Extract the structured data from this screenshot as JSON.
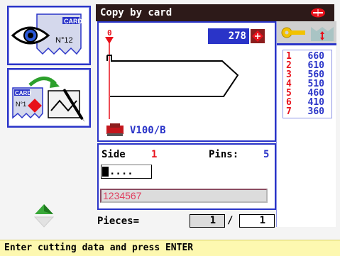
{
  "title_bar": {
    "title": "Copy by card"
  },
  "left_buttons": {
    "view_card": {
      "card_label": "CARD",
      "card_number": "N°12"
    },
    "copy_card": {
      "card_label": "CARD",
      "card_number": "N°1"
    }
  },
  "profile": {
    "value": "278",
    "origin_marker": "0",
    "machine": "V100/B"
  },
  "cuts": {
    "rows": [
      {
        "idx": "1",
        "val": "660"
      },
      {
        "idx": "2",
        "val": "610"
      },
      {
        "idx": "3",
        "val": "560"
      },
      {
        "idx": "4",
        "val": "510"
      },
      {
        "idx": "5",
        "val": "460"
      },
      {
        "idx": "6",
        "val": "410"
      },
      {
        "idx": "7",
        "val": "360"
      }
    ]
  },
  "cutting_data": {
    "side_label": "Side",
    "side_value": "1",
    "pins_label": "Pins:",
    "pins_value": "5",
    "code_input_value": "....",
    "code_display": "1234567"
  },
  "pieces": {
    "label": "Pieces=",
    "current": "1",
    "separator": "/",
    "total": "1"
  },
  "status_bar": {
    "message": "Enter cutting data and press ENTER"
  },
  "colors": {
    "accent_blue": "#2a34c8",
    "accent_red": "#e8101a",
    "title_bg": "#2d1a19",
    "status_bg": "#fdf8b0"
  },
  "icons": {
    "view_button": "eye-card-icon",
    "copy_button": "card-copy-icon",
    "title_logo": "brand-logo-icon",
    "machine": "cutting-machine-icon",
    "key_cut": "key-cut-icon",
    "navigation": "up-down-arrows-icon"
  }
}
